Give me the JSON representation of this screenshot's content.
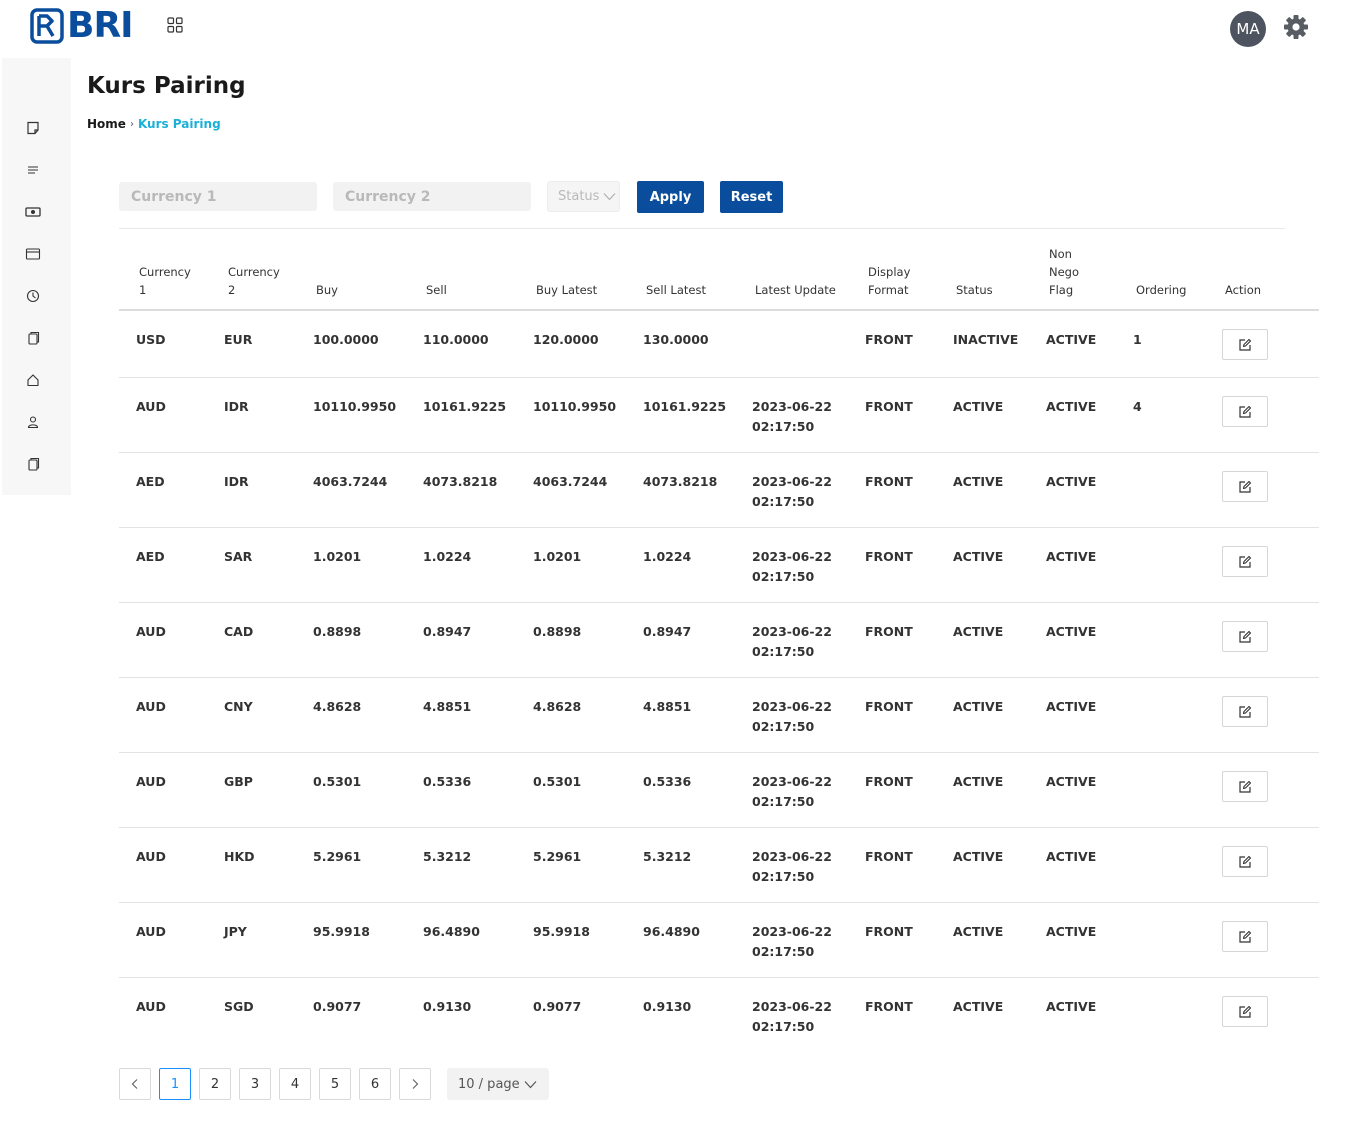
{
  "brand": {
    "name": "BRI",
    "color": "#0a4d9c"
  },
  "header": {
    "avatar_initials": "MA",
    "apps_icon": "grid-icon",
    "settings_icon": "gear-icon"
  },
  "sidebar": {
    "items": [
      {
        "icon": "note-icon"
      },
      {
        "icon": "list-icon"
      },
      {
        "icon": "money-icon"
      },
      {
        "icon": "card-icon"
      },
      {
        "icon": "clock-icon"
      },
      {
        "icon": "copy-icon"
      },
      {
        "icon": "home-icon"
      },
      {
        "icon": "user-icon"
      },
      {
        "icon": "copy-icon"
      }
    ]
  },
  "page": {
    "title": "Kurs Pairing"
  },
  "breadcrumb": {
    "home": "Home",
    "separator": "›",
    "current": "Kurs Pairing",
    "current_color": "#1bb0d6"
  },
  "filters": {
    "currency1_placeholder": "Currency 1",
    "currency2_placeholder": "Currency 2",
    "status_placeholder": "Status",
    "apply_label": "Apply",
    "reset_label": "Reset"
  },
  "table": {
    "headers": {
      "currency1": [
        "Currency",
        "1"
      ],
      "currency2": [
        "Currency",
        "2"
      ],
      "buy": "Buy",
      "sell": "Sell",
      "buy_latest": "Buy Latest",
      "sell_latest": "Sell Latest",
      "latest_update": "Latest Update",
      "display_format": [
        "Display",
        "Format"
      ],
      "status": "Status",
      "non_nego_flag": [
        "Non",
        "Nego",
        "Flag"
      ],
      "ordering": "Ordering",
      "action": "Action"
    },
    "rows": [
      {
        "c1": "USD",
        "c2": "EUR",
        "buy": "100.0000",
        "sell": "110.0000",
        "buy_latest": "120.0000",
        "sell_latest": "130.0000",
        "date": "",
        "time": "",
        "display": "FRONT",
        "status": "INACTIVE",
        "nego": "ACTIVE",
        "ordering": "1"
      },
      {
        "c1": "AUD",
        "c2": "IDR",
        "buy": "10110.9950",
        "sell": "10161.9225",
        "buy_latest": "10110.9950",
        "sell_latest": "10161.9225",
        "date": "2023-06-22",
        "time": "02:17:50",
        "display": "FRONT",
        "status": "ACTIVE",
        "nego": "ACTIVE",
        "ordering": "4"
      },
      {
        "c1": "AED",
        "c2": "IDR",
        "buy": "4063.7244",
        "sell": "4073.8218",
        "buy_latest": "4063.7244",
        "sell_latest": "4073.8218",
        "date": "2023-06-22",
        "time": "02:17:50",
        "display": "FRONT",
        "status": "ACTIVE",
        "nego": "ACTIVE",
        "ordering": ""
      },
      {
        "c1": "AED",
        "c2": "SAR",
        "buy": "1.0201",
        "sell": "1.0224",
        "buy_latest": "1.0201",
        "sell_latest": "1.0224",
        "date": "2023-06-22",
        "time": "02:17:50",
        "display": "FRONT",
        "status": "ACTIVE",
        "nego": "ACTIVE",
        "ordering": ""
      },
      {
        "c1": "AUD",
        "c2": "CAD",
        "buy": "0.8898",
        "sell": "0.8947",
        "buy_latest": "0.8898",
        "sell_latest": "0.8947",
        "date": "2023-06-22",
        "time": "02:17:50",
        "display": "FRONT",
        "status": "ACTIVE",
        "nego": "ACTIVE",
        "ordering": ""
      },
      {
        "c1": "AUD",
        "c2": "CNY",
        "buy": "4.8628",
        "sell": "4.8851",
        "buy_latest": "4.8628",
        "sell_latest": "4.8851",
        "date": "2023-06-22",
        "time": "02:17:50",
        "display": "FRONT",
        "status": "ACTIVE",
        "nego": "ACTIVE",
        "ordering": ""
      },
      {
        "c1": "AUD",
        "c2": "GBP",
        "buy": "0.5301",
        "sell": "0.5336",
        "buy_latest": "0.5301",
        "sell_latest": "0.5336",
        "date": "2023-06-22",
        "time": "02:17:50",
        "display": "FRONT",
        "status": "ACTIVE",
        "nego": "ACTIVE",
        "ordering": ""
      },
      {
        "c1": "AUD",
        "c2": "HKD",
        "buy": "5.2961",
        "sell": "5.3212",
        "buy_latest": "5.2961",
        "sell_latest": "5.3212",
        "date": "2023-06-22",
        "time": "02:17:50",
        "display": "FRONT",
        "status": "ACTIVE",
        "nego": "ACTIVE",
        "ordering": ""
      },
      {
        "c1": "AUD",
        "c2": "JPY",
        "buy": "95.9918",
        "sell": "96.4890",
        "buy_latest": "95.9918",
        "sell_latest": "96.4890",
        "date": "2023-06-22",
        "time": "02:17:50",
        "display": "FRONT",
        "status": "ACTIVE",
        "nego": "ACTIVE",
        "ordering": ""
      },
      {
        "c1": "AUD",
        "c2": "SGD",
        "buy": "0.9077",
        "sell": "0.9130",
        "buy_latest": "0.9077",
        "sell_latest": "0.9130",
        "date": "2023-06-22",
        "time": "02:17:50",
        "display": "FRONT",
        "status": "ACTIVE",
        "nego": "ACTIVE",
        "ordering": ""
      }
    ],
    "action_icon": "edit-icon"
  },
  "pagination": {
    "prev": "<",
    "pages": [
      "1",
      "2",
      "3",
      "4",
      "5",
      "6"
    ],
    "current_page": "1",
    "next": ">",
    "page_size": "10 / page",
    "active_color": "#1890ff"
  }
}
